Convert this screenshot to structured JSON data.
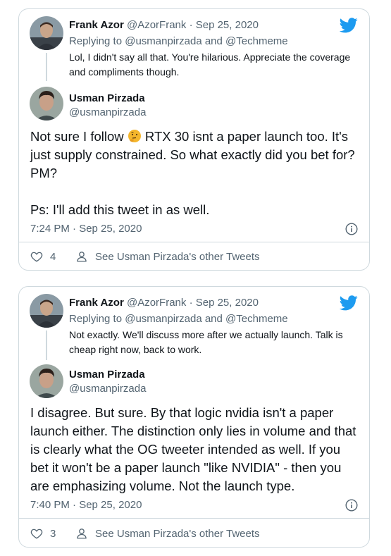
{
  "tweets": [
    {
      "quoted": {
        "name": "Frank Azor",
        "handle": "@AzorFrank",
        "separator": "·",
        "date": "Sep 25, 2020",
        "replying_prefix": "Replying to",
        "replying_to_1": "@usmanpirzada",
        "replying_and": "and",
        "replying_to_2": "@Techmeme",
        "text": "Lol, I didn't say all that. You're hilarious. Appreciate the coverage and compliments though."
      },
      "author": {
        "name": "Usman Pirzada",
        "handle": "@usmanpirzada"
      },
      "text_line1_before": "Not sure I follow",
      "text_line1_after": "RTX 30 isnt a paper launch too. It's just supply constrained. So what exactly did you bet for? PM?",
      "text_line2": "Ps: I'll add this tweet in as well.",
      "timestamp": "7:24 PM · Sep 25, 2020",
      "likes": "4",
      "other_tweets": "See Usman Pirzada's other Tweets",
      "emoji_icon": "thinking-face-icon"
    },
    {
      "quoted": {
        "name": "Frank Azor",
        "handle": "@AzorFrank",
        "separator": "·",
        "date": "Sep 25, 2020",
        "replying_prefix": "Replying to",
        "replying_to_1": "@usmanpirzada",
        "replying_and": "and",
        "replying_to_2": "@Techmeme",
        "text": "Not exactly. We'll discuss more after we actually launch. Talk is cheap right now, back to work."
      },
      "author": {
        "name": "Usman Pirzada",
        "handle": "@usmanpirzada"
      },
      "text": "I disagree. But sure. By that logic nvidia isn't a paper launch either. The distinction only lies in volume and that is clearly what the OG tweeter intended as well. If you bet it won't be a paper launch \"like NVIDIA\" - then you are emphasizing volume. Not the launch type.",
      "timestamp": "7:40 PM · Sep 25, 2020",
      "likes": "3",
      "other_tweets": "See Usman Pirzada's other Tweets"
    }
  ],
  "colors": {
    "twitter_blue": "#1d9bf0",
    "muted": "#536471",
    "border": "#cfd9de"
  }
}
